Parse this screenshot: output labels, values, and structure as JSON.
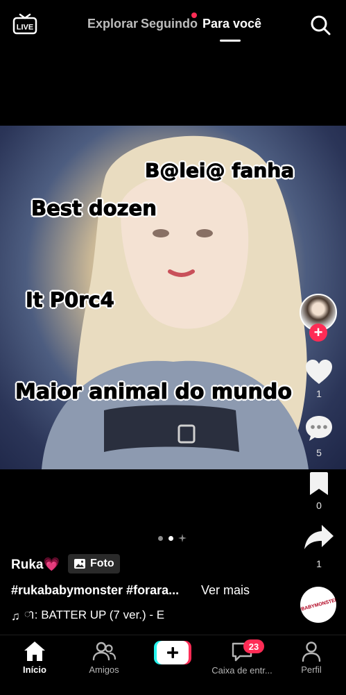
{
  "top_bar": {
    "live_label": "LIVE",
    "tabs": [
      "Explorar",
      "Seguindo",
      "Para você"
    ],
    "active_tab": "Para você"
  },
  "post": {
    "captions": [
      "B@lei@ fanha",
      "Best dozen",
      "It P0rc4",
      "Maior animal do mundo"
    ],
    "carousel": {
      "total": 3,
      "current": 2
    }
  },
  "actions": {
    "likes": "1",
    "comments": "5",
    "bookmarks": "0",
    "shares": "1",
    "music_disc_label": "#BABYMONSTER"
  },
  "info": {
    "username": "Ruka💗",
    "badge_label": "Foto",
    "hashtags": "#rukababymonster #forara...",
    "ver_mais": "Ver mais",
    "music": "ា: BATTER UP (7 ver.) - E"
  },
  "bottom_nav": {
    "items": [
      {
        "label": "Início",
        "icon": "home-icon"
      },
      {
        "label": "Amigos",
        "icon": "friends-icon"
      },
      {
        "label": "",
        "icon": "create-plus-icon"
      },
      {
        "label": "Caixa de entr...",
        "icon": "inbox-icon"
      },
      {
        "label": "Perfil",
        "icon": "profile-icon"
      }
    ],
    "inbox_count": "23"
  },
  "colors": {
    "accent": "#fe2c55",
    "cyan": "#25f4ee",
    "background": "#000000"
  }
}
